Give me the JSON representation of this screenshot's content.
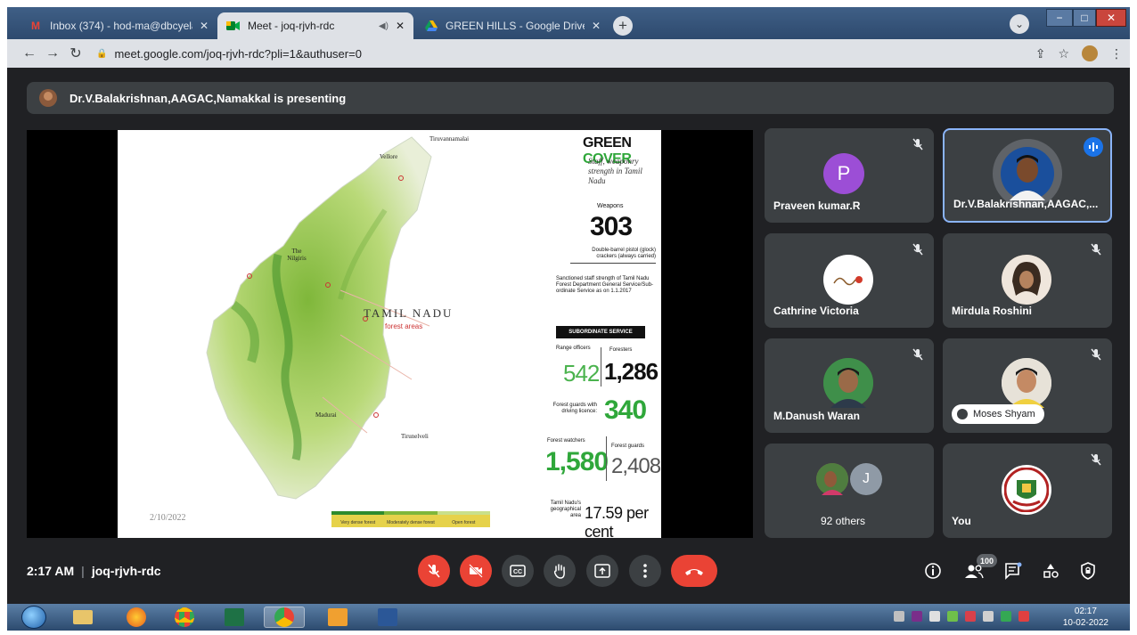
{
  "browser": {
    "tabs": [
      {
        "title": "Inbox (374) - hod-ma@dbcyelag",
        "icon": "gmail-icon",
        "active": false
      },
      {
        "title": "Meet - joq-rjvh-rdc",
        "icon": "meet-icon",
        "active": true,
        "audio": true
      },
      {
        "title": "GREEN HILLS - Google Drive",
        "icon": "drive-icon",
        "active": false
      }
    ],
    "url": "meet.google.com/joq-rjvh-rdc?pli=1&authuser=0",
    "window_buttons": [
      "−",
      "□",
      "✕"
    ]
  },
  "presenting_banner": {
    "text": "Dr.V.Balakrishnan,AAGAC,Namakkal is presenting"
  },
  "slide": {
    "date": "2/10/2022",
    "map_title": "TAMIL NADU",
    "map_subtitle": "forest areas",
    "places": [
      "Tiruvannamalai",
      "Vellore",
      "The Nilgiris",
      "Madurai",
      "Tirunelveli"
    ],
    "legend": [
      "Very dense forest",
      "Moderately dense forest",
      "Open forest"
    ],
    "heading_1": "GREEN",
    "heading_2": "COVER",
    "subtitle": "Staff, weaponry strength in Tamil Nadu",
    "weapons_label": "Weapons",
    "weapons_value": "303",
    "weapons_note": "Double-barrel pistol (glock) crackers (always carried)",
    "staff_note": "Sanctioned staff strength of Tamil Nadu Forest Department General Service/Sub-ordinate Service as on 1.1.2017",
    "subordinate_label": "SUBORDINATE SERVICE",
    "range_officers_label": "Range officers",
    "range_officers_value": "542",
    "foresters_label": "Foresters",
    "foresters_value": "1,286",
    "guards_licence_label": "Forest guards with driving licence:",
    "guards_licence_value": "340",
    "watchers_label": "Forest watchers",
    "watchers_value": "1,580",
    "guards_label": "Forest guards",
    "guards_value": "2,408",
    "area_label": "Tamil Nadu's geographical area",
    "area_value": "17.59 per cent"
  },
  "participants": [
    {
      "name": "Praveen kumar.R",
      "initial": "P",
      "avatar_color": "#9c4ed6",
      "muted": true
    },
    {
      "name": "Dr.V.Balakrishnan,AAGAC,...",
      "speaking": true
    },
    {
      "name": "Cathrine Victoria",
      "muted": true
    },
    {
      "name": "Mirdula Roshini",
      "muted": true
    },
    {
      "name": "M.Danush Waran",
      "muted": true
    },
    {
      "name": "Moses Shyam",
      "muted": true
    },
    {
      "name": "92 others",
      "initial": "J"
    },
    {
      "name": "You",
      "muted": true
    }
  ],
  "meeting": {
    "time": "2:17 AM",
    "separator": "|",
    "code": "joq-rjvh-rdc",
    "participant_count": "100"
  },
  "taskbar": {
    "clock_time": "02:17",
    "clock_date": "10-02-2022"
  }
}
